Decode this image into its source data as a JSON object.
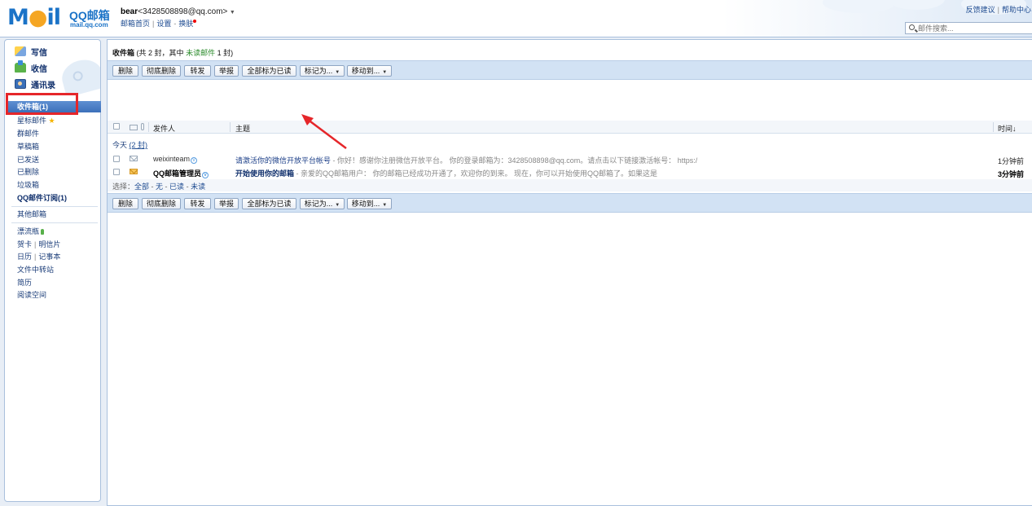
{
  "header": {
    "logo_text": "MOil",
    "brand": "QQ邮箱",
    "domain": "mail.qq.com",
    "user_name": "bear",
    "user_email": "<3428508898@qq.com>",
    "links": [
      "邮箱首页",
      "设置",
      "换肤"
    ],
    "right_links": [
      "反馈建议",
      "帮助中心"
    ],
    "search_placeholder": "邮件搜索..."
  },
  "sidebar": {
    "actions": [
      "写信",
      "收信",
      "通讯录"
    ],
    "folders": {
      "inbox": "收件箱(1)",
      "starred": "星标邮件",
      "group": "群邮件",
      "drafts": "草稿箱",
      "sent": "已发送",
      "deleted": "已删除",
      "spam": "垃圾箱",
      "subscription": "QQ邮件订阅(1)",
      "other": "其他邮箱",
      "bottle": "漂流瓶",
      "card": "贺卡",
      "postcard": "明信片",
      "calendar": "日历",
      "notes": "记事本",
      "file_transfer": "文件中转站",
      "resume": "简历",
      "reading": "阅读空间"
    }
  },
  "main": {
    "title": "收件箱",
    "summary_prefix": "(共 2 封，其中",
    "summary_unread": "未读邮件",
    "summary_suffix": "1 封)",
    "toolbar": {
      "delete": "删除",
      "delete_forever": "彻底删除",
      "forward": "转发",
      "report": "举报",
      "mark_all_read": "全部标为已读",
      "mark_as": "标记为...",
      "move_to": "移动到..."
    },
    "columns": {
      "sender": "发件人",
      "subject": "主题",
      "time": "时间↓"
    },
    "group": {
      "label": "今天",
      "count": "(2 封)"
    },
    "emails": [
      {
        "sender": "weixinteam",
        "subject": "请激活你的微信开放平台帐号",
        "preview": " - 你好！感谢你注册微信开放平台。 你的登录邮箱为：3428508898@qq.com。请点击以下链接激活帐号： https:/",
        "time": "1分钟前",
        "unread": false
      },
      {
        "sender": "QQ邮箱管理员",
        "subject": "开始使用你的邮箱",
        "preview": " - 亲爱的QQ邮箱用户： 你的邮箱已经成功开通了，欢迎你的到来。 现在，你可以开始使用QQ邮箱了。如果这是",
        "time": "3分钟前",
        "unread": true
      }
    ],
    "select": {
      "label": "选择：",
      "all": "全部",
      "none": "无",
      "read": "已读",
      "unread": "未读"
    }
  },
  "colors": {
    "accent_blue": "#1b73c7",
    "toolbar_bg": "#d2e2f4",
    "selected_folder": "#3c70ba",
    "highlight_red": "#e5262a"
  }
}
